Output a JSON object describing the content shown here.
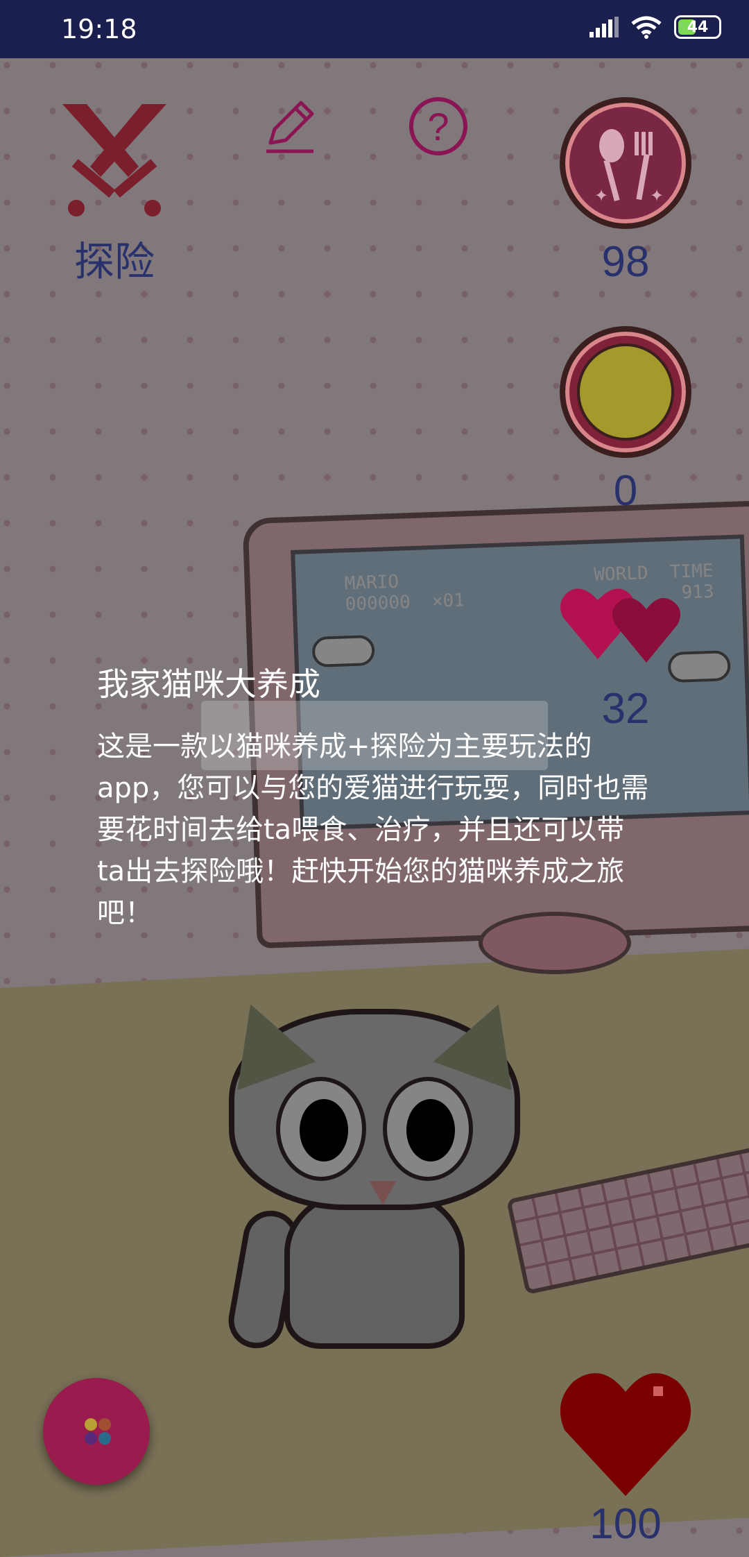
{
  "status_bar": {
    "time": "19:18",
    "battery": "44",
    "icons": [
      "signal-icon",
      "wifi-icon",
      "battery-icon"
    ]
  },
  "toolbar": {
    "explore_label": "探险",
    "icons": [
      "crossed-swords-icon",
      "edit-pencil-icon",
      "help-question-icon"
    ]
  },
  "stats": {
    "food": "98",
    "mood": "0",
    "affection": "32",
    "health": "100"
  },
  "dialog": {
    "title": "我家猫咪大养成",
    "body": "这是一款以猫咪养成+探险为主要玩法的app，您可以与您的爱猫进行玩耍，同时也需要花时间去给ta喂食、治疗，并且还可以带ta出去探险哦！赶快开始您的猫咪养成之旅吧！"
  },
  "scene": {
    "monitor_text_left": "MARIO\n000000  ×01",
    "monitor_text_right": "WORLD  TIME\n        913"
  },
  "colors": {
    "status_bar": "#1b1f4e",
    "stat_text": "#28316b",
    "accent": "#9a1c4e",
    "heart": "#c0135a",
    "health_heart": "#8a0000"
  }
}
